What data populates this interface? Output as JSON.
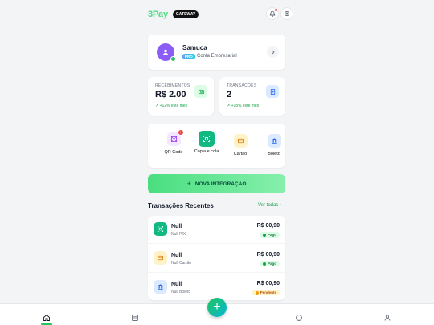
{
  "header": {
    "logo": "3Pay",
    "badge": "GATEWAY",
    "notification_icon": "bell-icon",
    "settings_icon": "gear-icon"
  },
  "profile": {
    "name": "Samuca",
    "plan": "PRO",
    "type": "Conta Empresarial"
  },
  "stats": [
    {
      "label": "RECEBIMENTOS",
      "value": "R$ 2.00",
      "trend": "↗ +12% este mês",
      "icon": "cash-icon"
    },
    {
      "label": "TRANSAÇÕES",
      "value": "2",
      "trend": "↗ +18% este mês",
      "icon": "receipt-icon"
    }
  ],
  "actions": [
    {
      "label": "QR Code",
      "icon": "qr-icon",
      "badge": "!"
    },
    {
      "label": "Copia e cola",
      "icon": "copy-scan-icon"
    },
    {
      "label": "Cartão",
      "icon": "card-icon"
    },
    {
      "label": "Boleto",
      "icon": "bank-icon"
    }
  ],
  "cta": {
    "label": "NOVA INTEGRAÇÃO",
    "plus": "+"
  },
  "transactions_section": {
    "title": "Transações Recentes",
    "see_all": "Ver todas"
  },
  "transactions": [
    {
      "name": "Null",
      "sub": "Null PIX",
      "amount": "R$ 00,90",
      "status": "Pago",
      "icon": "pix-icon"
    },
    {
      "name": "Null",
      "sub": "Null Cartão",
      "amount": "R$ 00,90",
      "status": "Pago",
      "icon": "card-icon"
    },
    {
      "name": "Null",
      "sub": "Null Boleto",
      "amount": "R$ 00,90",
      "status": "Pendente",
      "icon": "bank-icon"
    }
  ],
  "bottom_nav": {
    "items": [
      "home-icon",
      "list-icon",
      "add-icon",
      "support-icon",
      "user-icon"
    ],
    "fab": "+"
  },
  "colors": {
    "brand_green": "#4ade80",
    "success": "#16a34a",
    "pending": "#f59e0b",
    "avatar": "#8b5cf6"
  }
}
